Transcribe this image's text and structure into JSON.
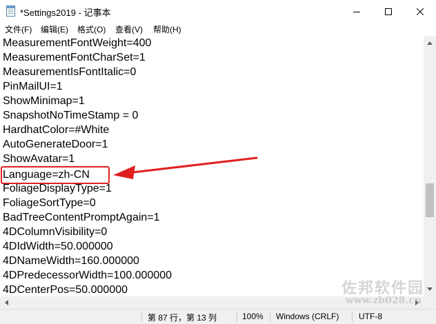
{
  "window": {
    "title": "*Settings2019 - 记事本",
    "icon": "notepad-icon",
    "controls": [
      "minimize-icon",
      "maximize-icon",
      "close-icon"
    ]
  },
  "menu": {
    "items": [
      "文件(F)",
      "编辑(E)",
      "格式(O)",
      "查看(V)",
      "帮助(H)"
    ]
  },
  "editor": {
    "lines": [
      "MeasurementFontWeight=400",
      "MeasurementFontCharSet=1",
      "MeasurementIsFontItalic=0",
      "PinMailUI=1",
      "ShowMinimap=1",
      "SnapshotNoTimeStamp = 0",
      "HardhatColor=#White",
      "AutoGenerateDoor=1",
      "ShowAvatar=1",
      "Language=zh-CN",
      "FoliageDisplayType=1",
      "FoliageSortType=0",
      "BadTreeContentPromptAgain=1",
      "4DColumnVisibility=0",
      "4DIdWidth=50.000000",
      "4DNameWidth=160.000000",
      "4DPredecessorWidth=100.000000",
      "4DCenterPos=50.000000"
    ],
    "highlighted_line": "Language=zh-CN"
  },
  "status": {
    "position": "第 87 行，第 13 列",
    "zoom": "100%",
    "line_ending": "Windows (CRLF)",
    "encoding": "UTF-8"
  },
  "watermark": {
    "text_cn": "佐邦软件园",
    "text_url": "www.zb028.cn"
  },
  "colors": {
    "annotation": "#e02020",
    "scrollbar_thumb": "#c1c1c1",
    "status_bg": "#f0f0f0"
  }
}
